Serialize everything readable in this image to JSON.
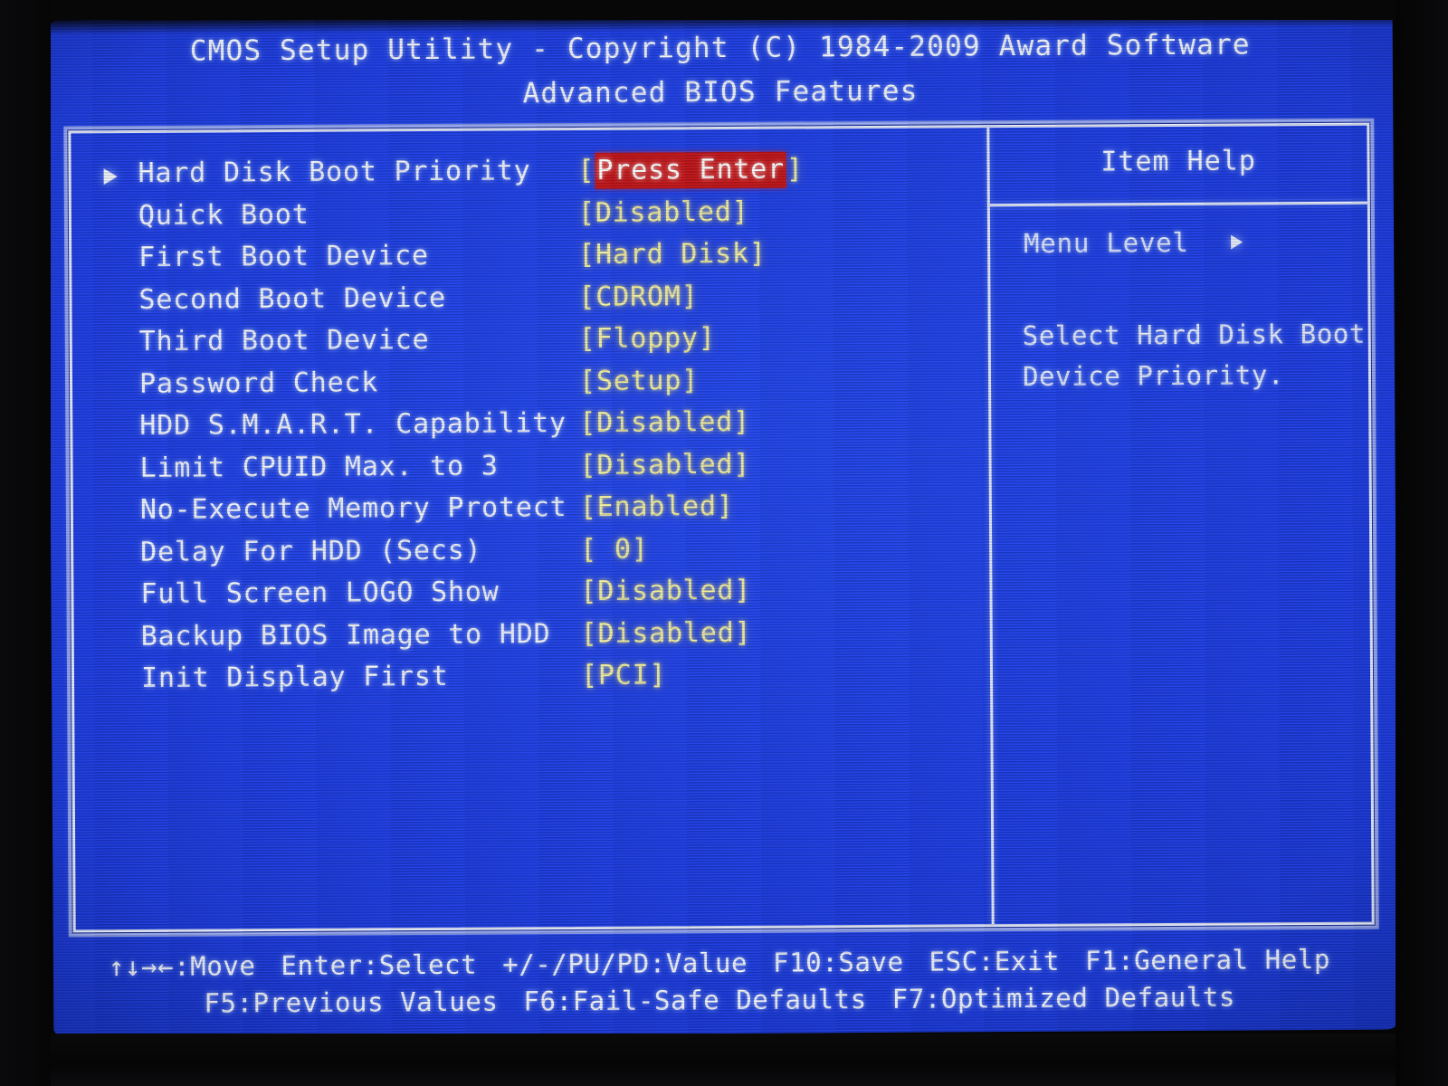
{
  "screen": {
    "title": "CMOS Setup Utility - Copyright (C) 1984-2009 Award Software",
    "subtitle": "Advanced BIOS Features"
  },
  "colors": {
    "background_blue": "#1d3de3",
    "label_white": "#f2f5ff",
    "value_yellow": "#f2efa0",
    "highlight_red": "#c2161a",
    "highlight_text": "#ffffff"
  },
  "settings": [
    {
      "label": "Hard Disk Boot Priority",
      "value": "Press Enter",
      "open_bracket": "[",
      "close_bracket": "]",
      "selected": true,
      "submenu": true
    },
    {
      "label": "Quick Boot",
      "value": "Disabled",
      "open_bracket": "[",
      "close_bracket": "]",
      "selected": false,
      "submenu": false
    },
    {
      "label": "First Boot Device",
      "value": "Hard Disk",
      "open_bracket": "[",
      "close_bracket": "]",
      "selected": false,
      "submenu": false
    },
    {
      "label": "Second Boot Device",
      "value": "CDROM",
      "open_bracket": "[",
      "close_bracket": "]",
      "selected": false,
      "submenu": false
    },
    {
      "label": "Third Boot Device",
      "value": "Floppy",
      "open_bracket": "[",
      "close_bracket": "]",
      "selected": false,
      "submenu": false
    },
    {
      "label": "Password Check",
      "value": "Setup",
      "open_bracket": "[",
      "close_bracket": "]",
      "selected": false,
      "submenu": false
    },
    {
      "label": "HDD S.M.A.R.T. Capability",
      "value": "Disabled",
      "open_bracket": "[",
      "close_bracket": "]",
      "selected": false,
      "submenu": false
    },
    {
      "label": "Limit CPUID Max. to 3",
      "value": "Disabled",
      "open_bracket": "[",
      "close_bracket": "]",
      "selected": false,
      "submenu": false
    },
    {
      "label": "No-Execute Memory Protect",
      "value": "Enabled",
      "open_bracket": "[",
      "close_bracket": "]",
      "selected": false,
      "submenu": false
    },
    {
      "label": "Delay For HDD (Secs)",
      "value": "  0",
      "open_bracket": "[",
      "close_bracket": "]",
      "selected": false,
      "submenu": false
    },
    {
      "label": "Full Screen LOGO Show",
      "value": "Disabled",
      "open_bracket": "[",
      "close_bracket": "]",
      "selected": false,
      "submenu": false
    },
    {
      "label": "Backup BIOS Image to HDD",
      "value": "Disabled",
      "open_bracket": "[",
      "close_bracket": "]",
      "selected": false,
      "submenu": false
    },
    {
      "label": "Init Display First",
      "value": "PCI",
      "open_bracket": "[",
      "close_bracket": "]",
      "selected": false,
      "submenu": false
    }
  ],
  "item_help": {
    "title": "Item Help",
    "menu_level_label": "Menu Level",
    "help_text": "Select Hard Disk Boot Device Priority."
  },
  "footer": {
    "line1": [
      "↑↓→←:Move",
      "Enter:Select",
      "+/-/PU/PD:Value",
      "F10:Save",
      "ESC:Exit",
      "F1:General Help"
    ],
    "line2": [
      "F5:Previous Values",
      "F6:Fail-Safe Defaults",
      "F7:Optimized Defaults"
    ]
  }
}
